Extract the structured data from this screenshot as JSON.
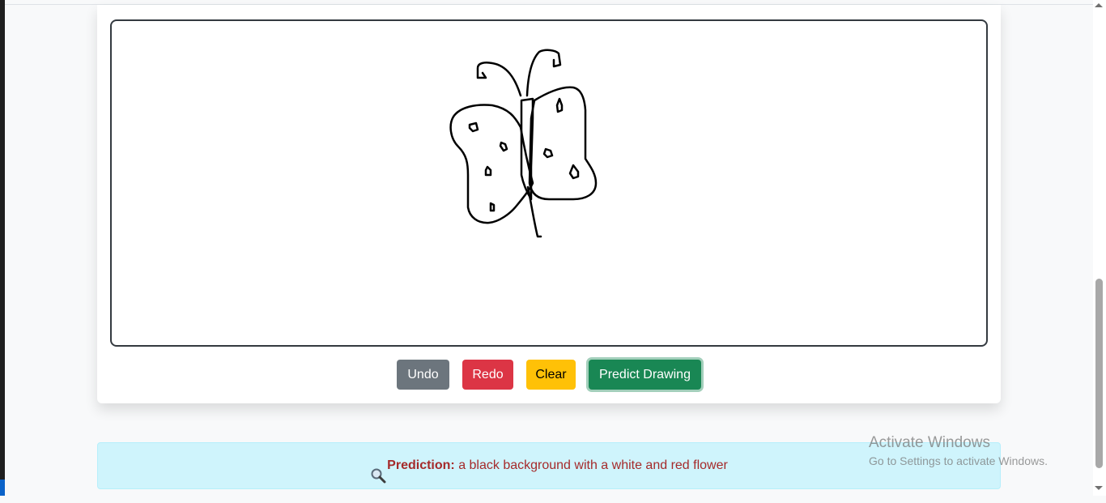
{
  "toolbar": {
    "undo_label": "Undo",
    "redo_label": "Redo",
    "clear_label": "Clear",
    "predict_label": "Predict Drawing"
  },
  "result": {
    "icon": "magnifier-icon",
    "label": "Prediction:",
    "text": "a black background with a white and red flower"
  },
  "watermark": {
    "title": "Activate Windows",
    "subtitle": "Go to Settings to activate Windows."
  },
  "colors": {
    "undo": "#6c757d",
    "redo": "#dc3545",
    "clear": "#ffc107",
    "predict": "#198754",
    "alert_bg": "#cff4fc",
    "prediction_text": "#a52a2a"
  }
}
